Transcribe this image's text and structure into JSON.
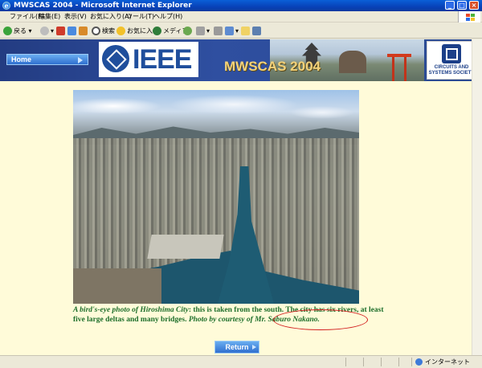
{
  "window": {
    "title": "MWSCAS 2004 - Microsoft Internet Explorer"
  },
  "menu": [
    "ファイル(F)",
    "編集(E)",
    "表示(V)",
    "お気に入り(A)",
    "ツール(T)",
    "ヘルプ(H)"
  ],
  "toolbar": {
    "back_label": "戻る",
    "search_label": "検索",
    "favorites_label": "お気に入り",
    "media_label": "メディア"
  },
  "banner": {
    "home_label": "Home",
    "ieee_text": "IEEE",
    "conference_title": "MWSCAS 2004",
    "society_text": "CIRCUITS AND SYSTEMS SOCIETY"
  },
  "caption": {
    "part1": "A bird's-eye photo of Hiroshima City",
    "part2": ": this is taken from the south. The city has six rivers, at least five large deltas and many bridges. ",
    "part3": "Photo by courtesy of Mr. Saburo Nakano."
  },
  "return_label": "Return",
  "status": {
    "zone": "インターネット"
  },
  "colors": {
    "caption": "#1d6e2a",
    "highlight_oval": "#d21e1e",
    "page_bg": "#fffbd9",
    "banner": "#2f4fa0"
  }
}
